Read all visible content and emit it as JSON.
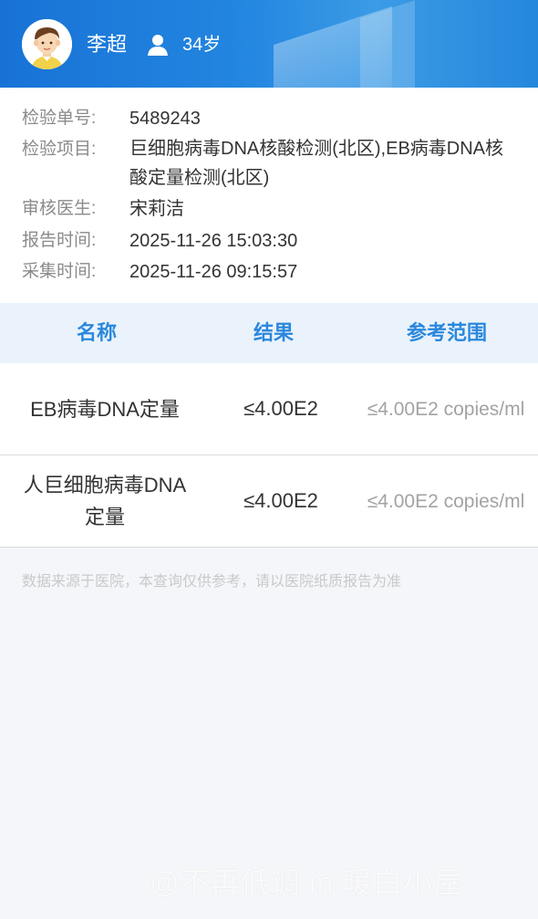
{
  "patient": {
    "name": "李超",
    "age": "34岁",
    "avatar_icon": "user-avatar-icon",
    "gender_icon": "person-icon"
  },
  "info": {
    "order_no_label": "检验单号:",
    "order_no": "5489243",
    "items_label": "检验项目:",
    "items": "巨细胞病毒DNA核酸检测(北区),EB病毒DNA核酸定量检测(北区)",
    "doctor_label": "审核医生:",
    "doctor": "宋莉洁",
    "report_time_label": "报告时间:",
    "report_time": "2025-11-26 15:03:30",
    "collect_time_label": "采集时间:",
    "collect_time": "2025-11-26 09:15:57"
  },
  "table": {
    "headers": [
      "名称",
      "结果",
      "参考范围"
    ],
    "rows": [
      {
        "name": "EB病毒DNA定量",
        "result": "≤4.00E2",
        "reference": "≤4.00E2 copies/ml"
      },
      {
        "name": "人巨细胞病毒DNA定量",
        "result": "≤4.00E2",
        "reference": "≤4.00E2 copies/ml"
      }
    ]
  },
  "notice": "数据来源于医院，本查询仅供参考，请以医院纸质报告为准",
  "watermark": "@不再低调 in 暖白小屋",
  "colors": {
    "header_blue": "#1f7fdc",
    "table_header_text": "#2b88dc",
    "table_header_bg": "#eaf3fc"
  }
}
